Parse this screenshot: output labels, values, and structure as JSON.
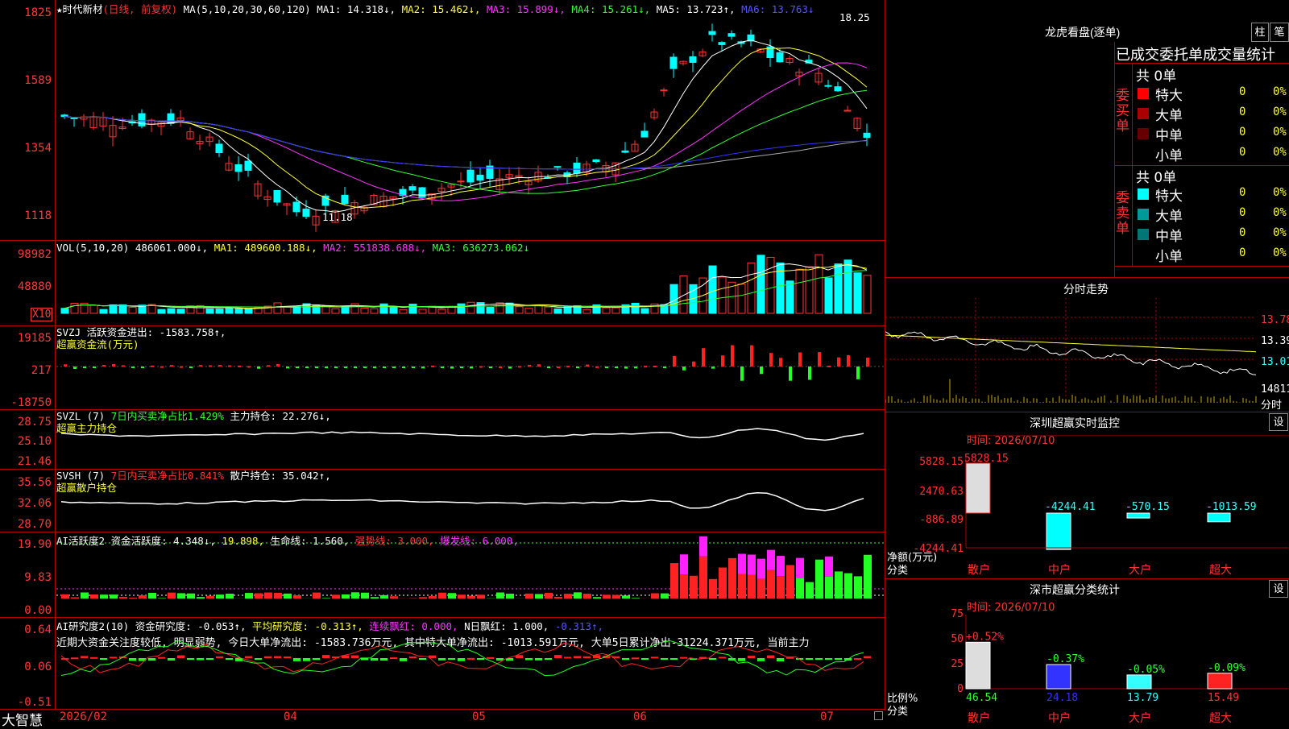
{
  "main": {
    "header_title": "★时代新材",
    "header_mode": "(日线, 前复权)",
    "ma_label": "MA(5,10,20,30,60,120)",
    "ma1": "MA1: 14.318↓,",
    "ma2": "MA2: 15.462↓,",
    "ma3": "MA3: 15.899↓,",
    "ma4": "MA4: 15.261↓,",
    "ma5": "MA5: 13.723↑,",
    "ma6": "MA6: 13.763↓",
    "axis": [
      "1825",
      "1589",
      "1354",
      "1118"
    ],
    "high_mark": "18.25",
    "low_mark": "11.18"
  },
  "vol": {
    "label": "VOL(5,10,20)",
    "value": "486061.000↓,",
    "ma1": "MA1: 489600.188↓,",
    "ma2": "MA2: 551838.688↓,",
    "ma3": "MA3: 636273.062↓",
    "axis": [
      "98982",
      "48880"
    ],
    "unit": "X10"
  },
  "svzj": {
    "label": "SVZJ  活跃资金进出: -1583.758↑,",
    "sub": "超赢资金流(万元)",
    "axis": [
      "19185",
      "217",
      "-18750"
    ]
  },
  "svzl": {
    "label1": "SVZL (7)",
    "label2": "7日内买卖净占比1.429%",
    "label3": "主力持仓: 22.276↓,",
    "sub": "超赢主力持仓",
    "axis": [
      "28.75",
      "25.10",
      "21.46"
    ]
  },
  "svsh": {
    "label1": "SVSH (7)",
    "label2": "7日内买卖净占比0.841%",
    "label3": "散户持仓: 35.042↑,",
    "sub": "超赢散户持仓",
    "axis": [
      "35.56",
      "32.06",
      "28.70"
    ]
  },
  "ai2": {
    "label1": "AI活跃度2",
    "label2": "资金活跃度: 4.348↓,",
    "label3": "19.898,",
    "label4": "生命线: 1.560,",
    "label5": "强势线: 3.000,",
    "label6": "爆发线: 6.000,",
    "axis": [
      "19.90",
      "9.83",
      "0.00"
    ]
  },
  "ai3": {
    "label1": "AI研究度2(10)",
    "label2": "资金研究度: -0.053↑,",
    "label3": "平均研究度: -0.313↑,",
    "label4": "连续飘红: 0.000,",
    "label5": "N日飘红: 1.000,",
    "label6": "-0.313↑,",
    "comment": "近期大资金关注度较低, 明显弱势, 今日大单净流出: -1583.736万元, 其中特大单净流出: -1013.591万元, 大单5日累计净出-31224.371万元, 当前主力",
    "axis": [
      "0.64",
      "0.06",
      "-0.51"
    ]
  },
  "bottom": {
    "brand": "大智慧",
    "dates": [
      "2026/02",
      "04",
      "05",
      "06",
      "07"
    ]
  },
  "dragon": {
    "title": "龙虎看盘(逐单)",
    "btn_zhu": "柱",
    "btn_bi": "笔",
    "subtitle": "已成交委托单成交量统计",
    "buy_label": "委买单",
    "sell_label": "委卖单",
    "buy_total": "共 0单",
    "sell_total": "共 0单",
    "buy_rows": [
      {
        "name": "特大",
        "count": "0",
        "pct": "0%",
        "color": "#ff0000"
      },
      {
        "name": "大单",
        "count": "0",
        "pct": "0%",
        "color": "#aa0000"
      },
      {
        "name": "中单",
        "count": "0",
        "pct": "0%",
        "color": "#660000"
      },
      {
        "name": "小单",
        "count": "0",
        "pct": "0%",
        "color": ""
      }
    ],
    "sell_rows": [
      {
        "name": "特大",
        "count": "0",
        "pct": "0%",
        "color": "#00ffff"
      },
      {
        "name": "大单",
        "count": "0",
        "pct": "0%",
        "color": "#009999"
      },
      {
        "name": "中单",
        "count": "0",
        "pct": "0%",
        "color": "#007777"
      },
      {
        "name": "小单",
        "count": "0",
        "pct": "0%",
        "color": ""
      }
    ]
  },
  "fenshi": {
    "title": "分时走势",
    "axis": [
      "13.78",
      "13.39",
      "13.01",
      "14811",
      "分时"
    ]
  },
  "monitor": {
    "title": "深圳超赢实时监控",
    "btn": "设",
    "time": "时间: 2026/07/10",
    "axis": [
      "5828.15",
      "2470.63",
      "-886.89",
      "-4244.41"
    ],
    "ylabel": "净额(万元)",
    "xlabel": "分类",
    "bars": [
      {
        "name": "散户",
        "value": "5828.15"
      },
      {
        "name": "中户",
        "value": "-4244.41"
      },
      {
        "name": "大户",
        "value": "-570.15"
      },
      {
        "name": "超大",
        "value": "-1013.59"
      }
    ]
  },
  "classify": {
    "title": "深市超赢分类统计",
    "btn": "设",
    "time": "时间: 2026/07/10",
    "axis": [
      "75",
      "50",
      "25",
      "0"
    ],
    "ylabel": "比例%",
    "xlabel": "分类",
    "bars": [
      {
        "name": "散户",
        "top": "+0.52%",
        "value": "46.54"
      },
      {
        "name": "中户",
        "top": "-0.37%",
        "value": "24.18"
      },
      {
        "name": "大户",
        "top": "-0.05%",
        "value": "13.79"
      },
      {
        "name": "超大",
        "top": "-0.09%",
        "value": "15.49"
      }
    ]
  }
}
